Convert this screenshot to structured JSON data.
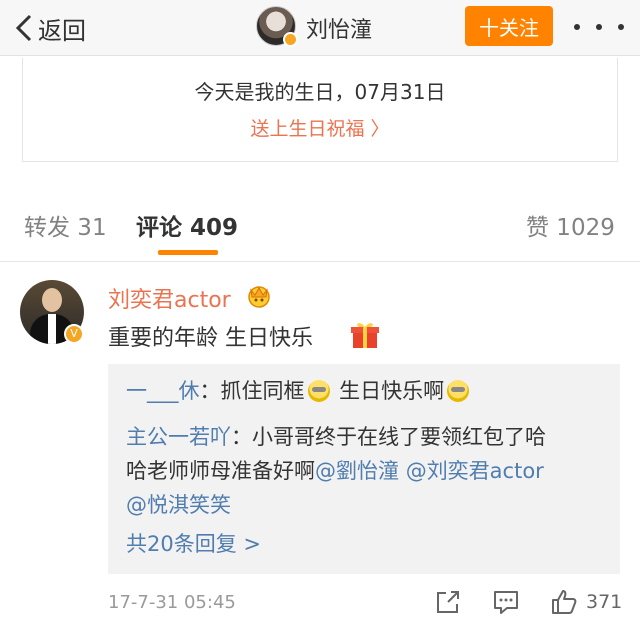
{
  "nav": {
    "back_label": "返回",
    "user_name": "刘怡潼",
    "follow_label": "十关注"
  },
  "birthday": {
    "text": "今天是我的生日，07月31日",
    "link": "送上生日祝福 〉"
  },
  "tabs": {
    "repost": "转发 31",
    "comments": "评论 409",
    "likes": "赞 1029"
  },
  "comment": {
    "user_name": "刘奕君actor",
    "text": "重要的年龄 生日快乐",
    "time": "17-7-31 05:45",
    "like_count": "371",
    "replies": [
      {
        "user": "一___休",
        "sep": "：",
        "text_a": "抓住同框",
        "text_b": " 生日快乐啊"
      },
      {
        "user": "主公一若吖",
        "sep": "：",
        "line1": "小哥哥终于在线了要领红包了哈",
        "line2a": "哈老师师母准备好啊",
        "m1": "@劉怡潼",
        "m2": "@刘奕君actor",
        "m3": "@悦淇笑笑"
      }
    ],
    "more_replies": "共20条回复 >"
  },
  "colors": {
    "accent_orange": "#ff8200",
    "link_orange": "#eb7350",
    "link_blue": "#507daf"
  }
}
